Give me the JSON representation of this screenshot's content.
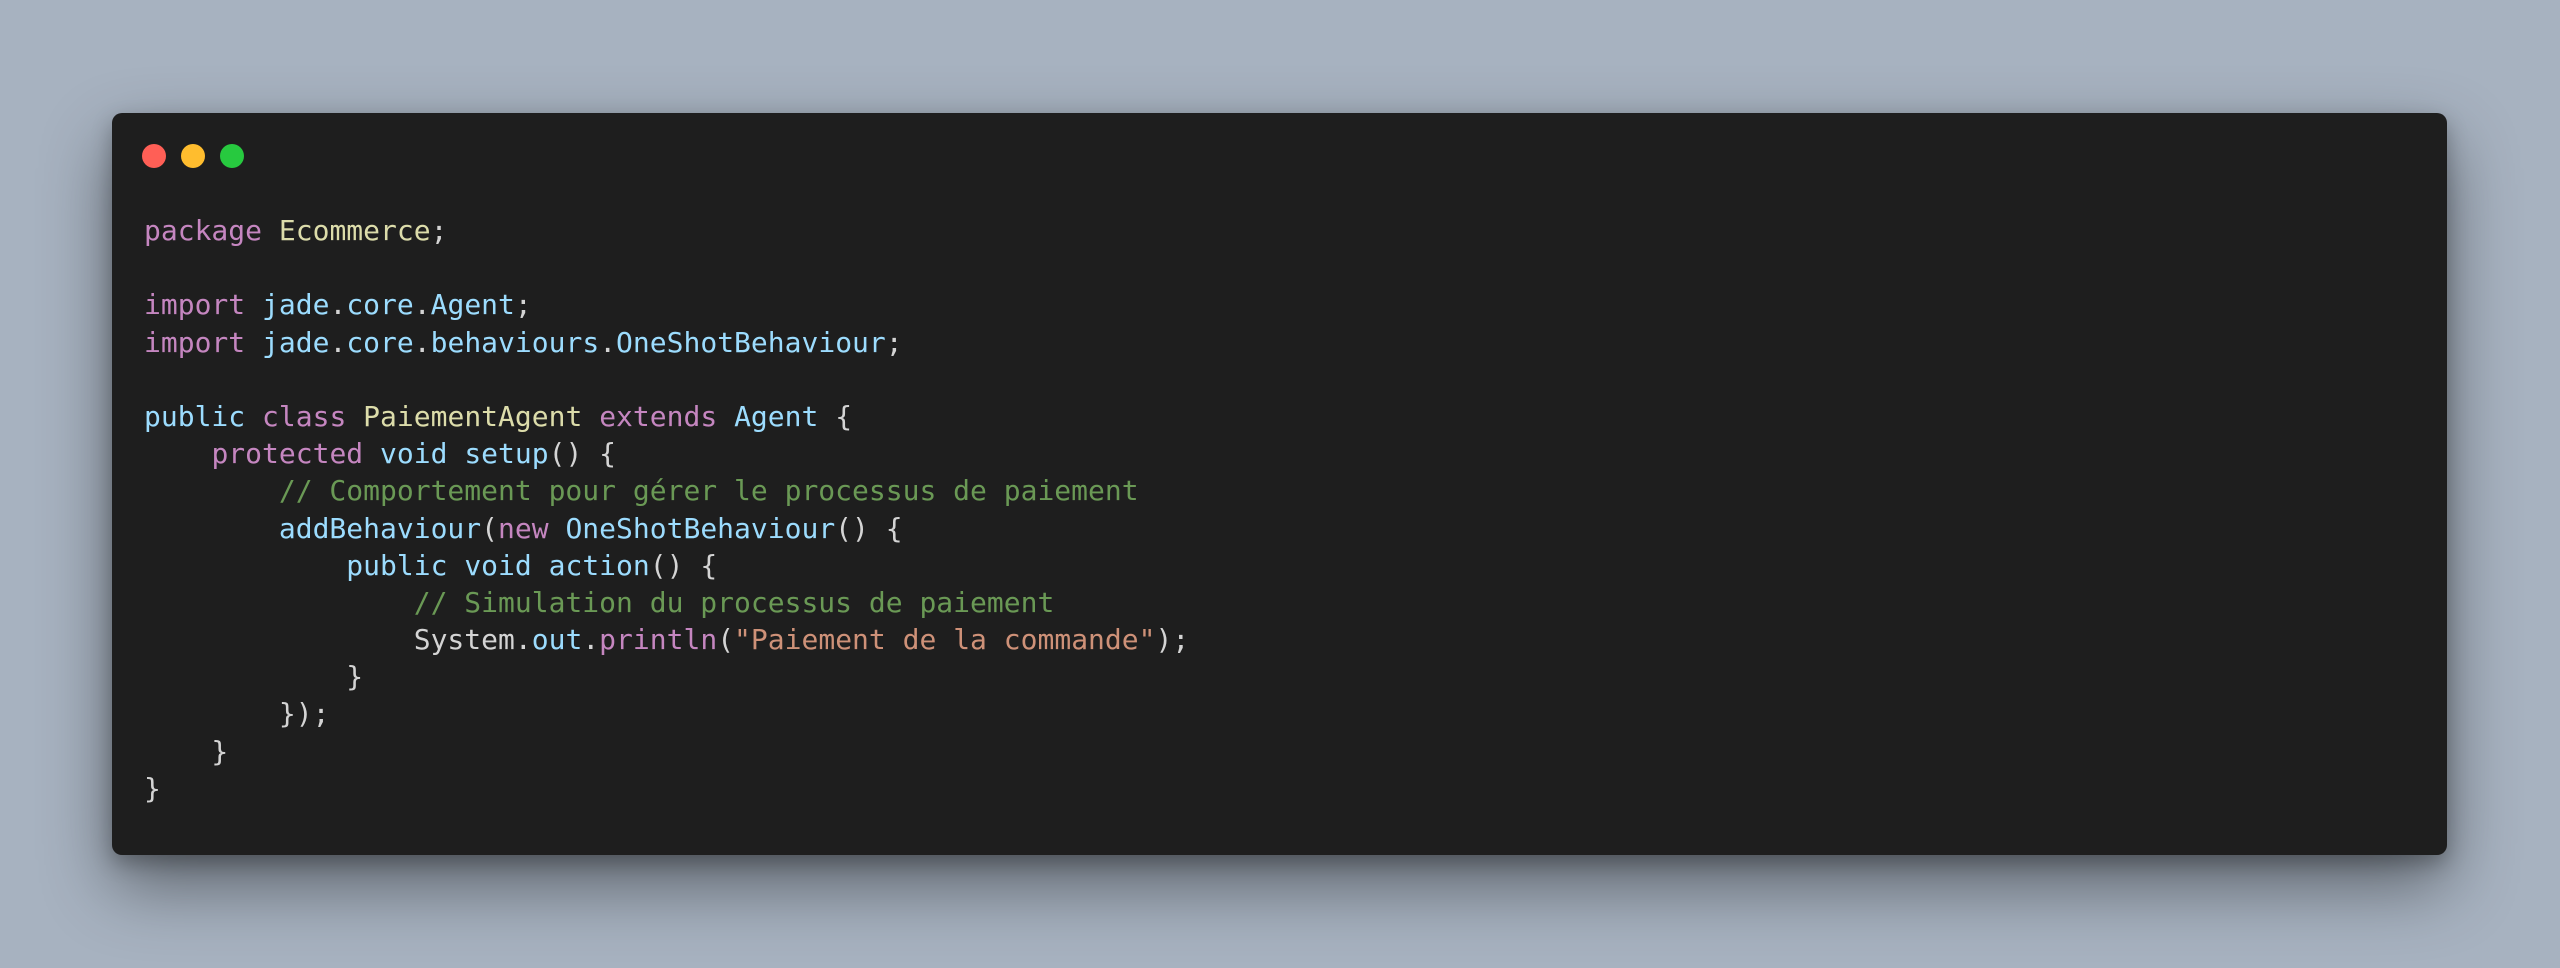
{
  "window": {
    "controls": [
      {
        "name": "close",
        "color": "#ff5f56"
      },
      {
        "name": "minimize",
        "color": "#ffbd2e"
      },
      {
        "name": "maximize",
        "color": "#27c93f"
      }
    ]
  },
  "theme": {
    "background": "#a7b2c0",
    "editor_background": "#1e1e1e",
    "keyword": "#c586c0",
    "storage": "#9cdcfe",
    "type": "#dcdcaa",
    "identifier": "#9cdcfe",
    "plain": "#d4d4d4",
    "comment": "#6a9955",
    "string": "#ce9178"
  },
  "code": {
    "language": "java",
    "lines": [
      [
        {
          "t": "package",
          "c": "kw"
        },
        {
          "t": " ",
          "c": "pl"
        },
        {
          "t": "Ecommerce",
          "c": "ty"
        },
        {
          "t": ";",
          "c": "pl"
        }
      ],
      [],
      [
        {
          "t": "import",
          "c": "kw"
        },
        {
          "t": " ",
          "c": "pl"
        },
        {
          "t": "jade",
          "c": "id"
        },
        {
          "t": ".",
          "c": "pl"
        },
        {
          "t": "core",
          "c": "id"
        },
        {
          "t": ".",
          "c": "pl"
        },
        {
          "t": "Agent",
          "c": "id"
        },
        {
          "t": ";",
          "c": "pl"
        }
      ],
      [
        {
          "t": "import",
          "c": "kw"
        },
        {
          "t": " ",
          "c": "pl"
        },
        {
          "t": "jade",
          "c": "id"
        },
        {
          "t": ".",
          "c": "pl"
        },
        {
          "t": "core",
          "c": "id"
        },
        {
          "t": ".",
          "c": "pl"
        },
        {
          "t": "behaviours",
          "c": "id"
        },
        {
          "t": ".",
          "c": "pl"
        },
        {
          "t": "OneShotBehaviour",
          "c": "id"
        },
        {
          "t": ";",
          "c": "pl"
        }
      ],
      [],
      [
        {
          "t": "public",
          "c": "st"
        },
        {
          "t": " ",
          "c": "pl"
        },
        {
          "t": "class",
          "c": "kw"
        },
        {
          "t": " ",
          "c": "pl"
        },
        {
          "t": "PaiementAgent",
          "c": "ty"
        },
        {
          "t": " ",
          "c": "pl"
        },
        {
          "t": "extends",
          "c": "kw"
        },
        {
          "t": " ",
          "c": "pl"
        },
        {
          "t": "Agent",
          "c": "id"
        },
        {
          "t": " {",
          "c": "pl"
        }
      ],
      [
        {
          "t": "    ",
          "c": "pl"
        },
        {
          "t": "protected",
          "c": "kw"
        },
        {
          "t": " ",
          "c": "pl"
        },
        {
          "t": "void",
          "c": "st"
        },
        {
          "t": " ",
          "c": "pl"
        },
        {
          "t": "setup",
          "c": "id"
        },
        {
          "t": "() {",
          "c": "pl"
        }
      ],
      [
        {
          "t": "        ",
          "c": "pl"
        },
        {
          "t": "// Comportement pour gérer le processus de paiement",
          "c": "cm"
        }
      ],
      [
        {
          "t": "        ",
          "c": "pl"
        },
        {
          "t": "addBehaviour",
          "c": "id"
        },
        {
          "t": "(",
          "c": "pl"
        },
        {
          "t": "new",
          "c": "kw"
        },
        {
          "t": " ",
          "c": "pl"
        },
        {
          "t": "OneShotBehaviour",
          "c": "id"
        },
        {
          "t": "() {",
          "c": "pl"
        }
      ],
      [
        {
          "t": "            ",
          "c": "pl"
        },
        {
          "t": "public",
          "c": "st"
        },
        {
          "t": " ",
          "c": "pl"
        },
        {
          "t": "void",
          "c": "st"
        },
        {
          "t": " ",
          "c": "pl"
        },
        {
          "t": "action",
          "c": "id"
        },
        {
          "t": "() {",
          "c": "pl"
        }
      ],
      [
        {
          "t": "                ",
          "c": "pl"
        },
        {
          "t": "// Simulation du processus de paiement",
          "c": "cm"
        }
      ],
      [
        {
          "t": "                ",
          "c": "pl"
        },
        {
          "t": "System",
          "c": "pl"
        },
        {
          "t": ".",
          "c": "pl"
        },
        {
          "t": "out",
          "c": "id"
        },
        {
          "t": ".",
          "c": "pl"
        },
        {
          "t": "println",
          "c": "kw"
        },
        {
          "t": "(",
          "c": "pl"
        },
        {
          "t": "\"Paiement de la commande\"",
          "c": "str"
        },
        {
          "t": ");",
          "c": "pl"
        }
      ],
      [
        {
          "t": "            }",
          "c": "pl"
        }
      ],
      [
        {
          "t": "        });",
          "c": "pl"
        }
      ],
      [
        {
          "t": "    }",
          "c": "pl"
        }
      ],
      [
        {
          "t": "}",
          "c": "pl"
        }
      ]
    ]
  }
}
